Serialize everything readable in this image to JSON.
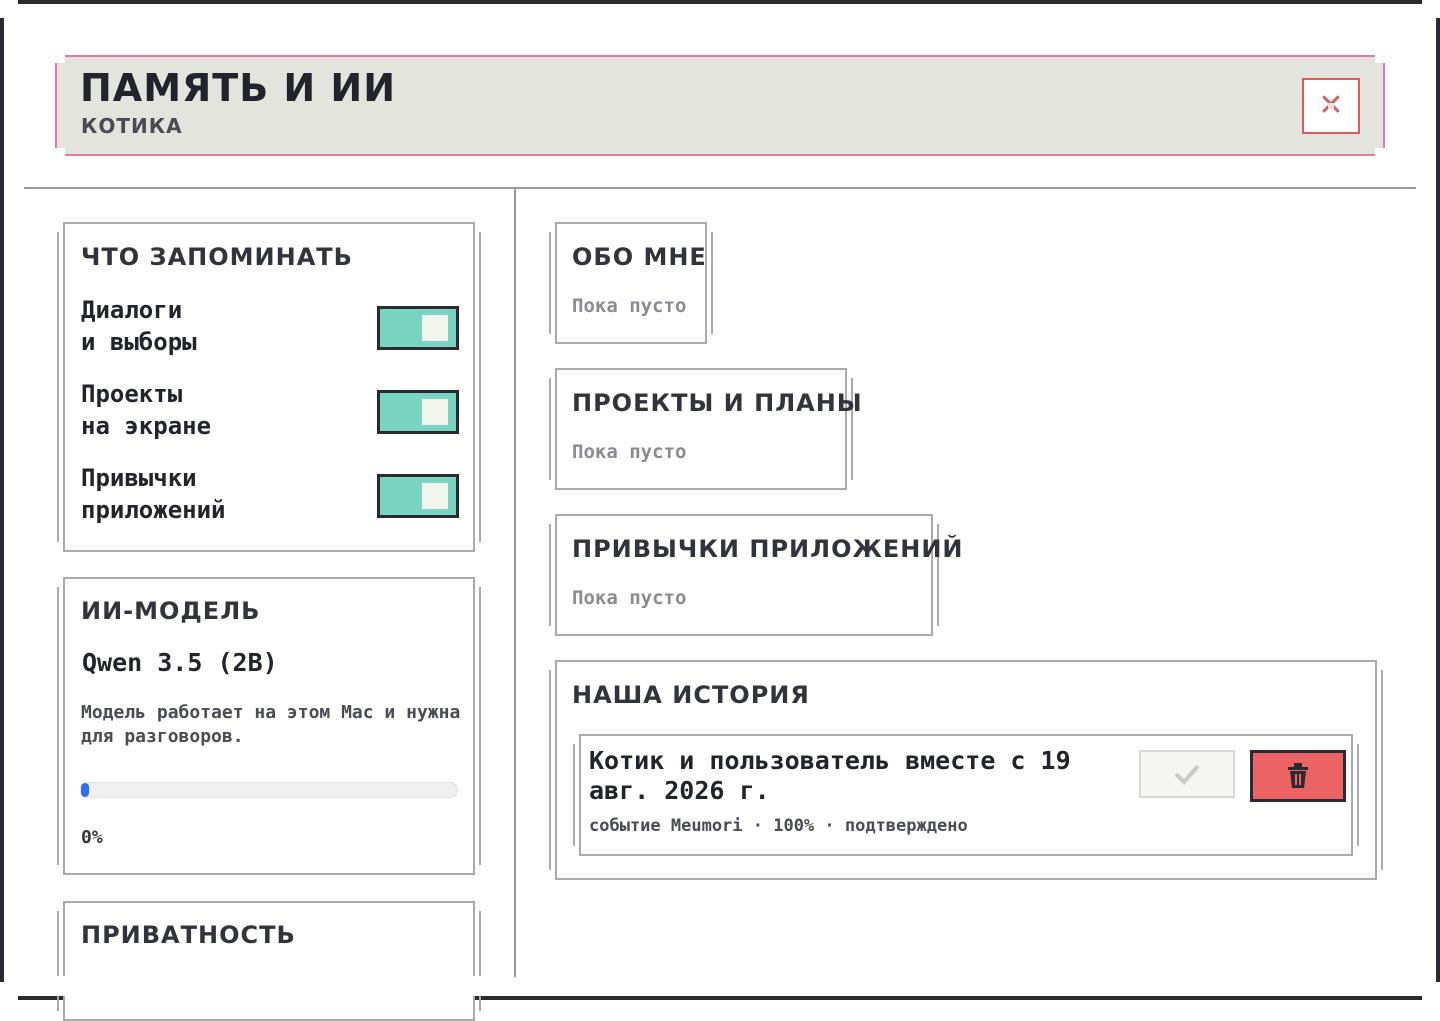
{
  "header": {
    "title": "ПАМЯТЬ И ИИ",
    "subtitle": "КОТИКА",
    "close_icon": "close-icon"
  },
  "memory_settings": {
    "title": "ЧТО ЗАПОМИНАТЬ",
    "toggles": [
      {
        "label": "Диалоги\nи выборы",
        "on": true
      },
      {
        "label": "Проекты\nна экране",
        "on": true
      },
      {
        "label": "Привычки\nприложений",
        "on": true
      }
    ]
  },
  "ai_model": {
    "title": "ИИ-МОДЕЛЬ",
    "name": "Qwen 3.5 (2B)",
    "description": "Модель работает на этом Mac и нужна для разговоров.",
    "progress": 0,
    "progress_label": "0%"
  },
  "privacy": {
    "title": "ПРИВАТНОСТЬ"
  },
  "memory_sections": [
    {
      "title": "ОБО МНЕ",
      "empty_text": "Пока пусто"
    },
    {
      "title": "ПРОЕКТЫ И ПЛАНЫ",
      "empty_text": "Пока пусто"
    },
    {
      "title": "ПРИВЫЧКИ ПРИЛОЖЕНИЙ",
      "empty_text": "Пока пусто"
    }
  ],
  "history": {
    "title": "НАША ИСТОРИЯ",
    "events": [
      {
        "text": "Котик и пользователь вместе с 19 авг. 2026 г.",
        "meta": "событие Meumori · 100% · подтверждено",
        "confirm_icon": "check-icon",
        "delete_icon": "trash-icon"
      }
    ]
  },
  "colors": {
    "header_border": "#e27aa2",
    "header_bg": "#e4e4de",
    "toggle_on": "#79d4c2",
    "progress": "#2f6fe8",
    "delete": "#ec6363",
    "close": "#e05a5a"
  }
}
